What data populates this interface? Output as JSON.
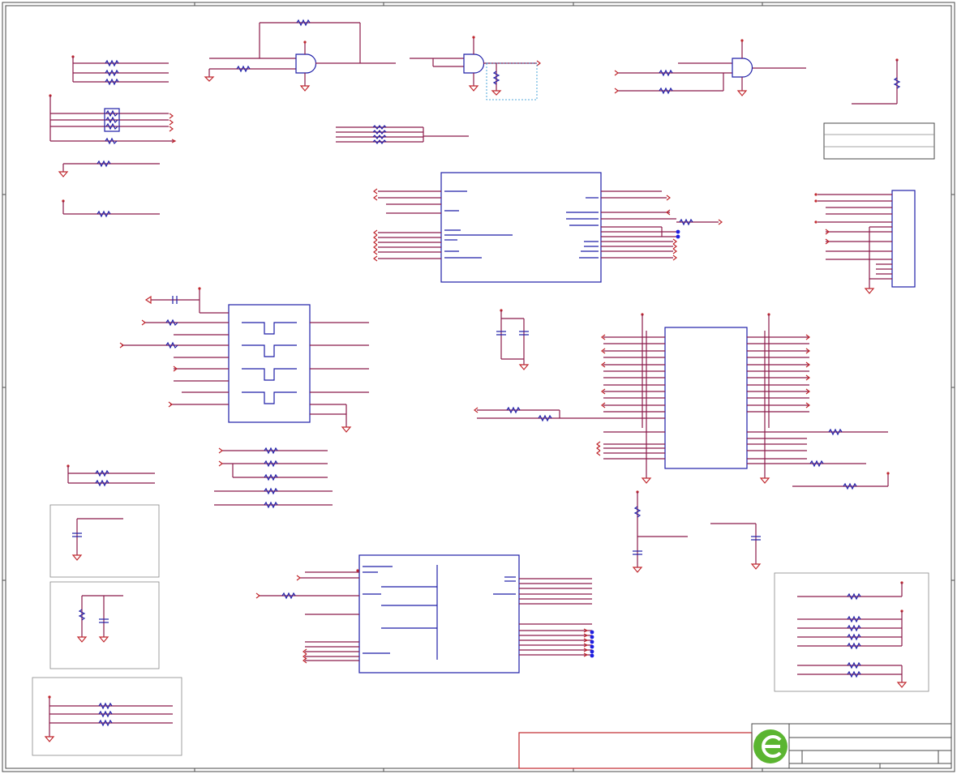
{
  "schematic": {
    "title_block_text": [],
    "logo": {
      "name": "e-logo",
      "color": "#5bb531"
    },
    "colors": {
      "wire": "#8b1a4a",
      "component": "#1f1fa8",
      "power": "#c0272d",
      "border": "#4a4a4a",
      "dashed_box": "#1f8fcf"
    }
  }
}
